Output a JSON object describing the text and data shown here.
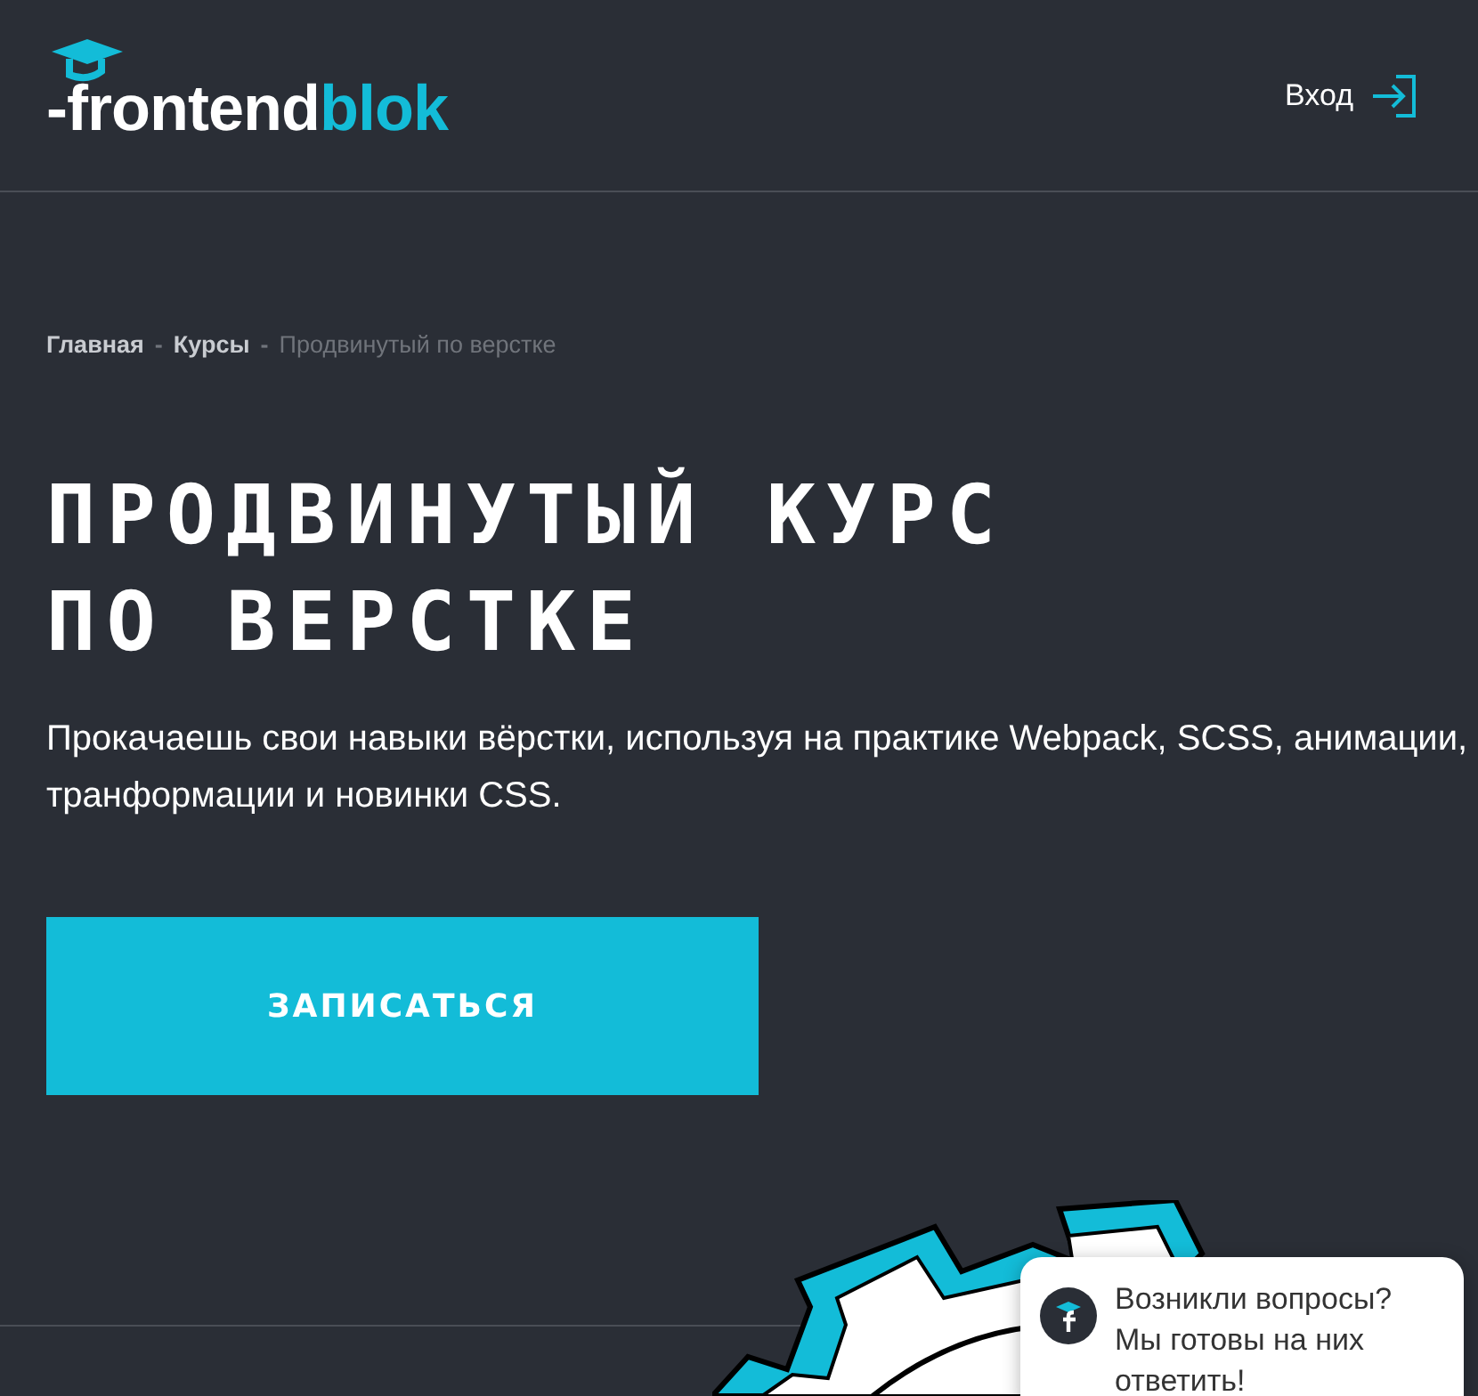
{
  "header": {
    "logo": {
      "part_1": "-frontend",
      "part_2": "blok"
    },
    "login": "Вход"
  },
  "breadcrumbs": [
    {
      "label": "Главная",
      "current": false
    },
    {
      "label": "Курсы",
      "current": false
    },
    {
      "label": "Продвинутый по верстке",
      "current": true
    }
  ],
  "separator": "-",
  "title_lines": [
    "ПРОДВИНУТЫЙ КУРС",
    "ПО ВЕРСТКЕ"
  ],
  "description": "Прокачаешь свои навыки вёрстки, используя на практике Webpack, SCSS, анимации, транформации и новинки CSS.",
  "cta_button": "ЗАПИСАТЬСЯ",
  "chat_popup": {
    "text": "Возникли вопросы? Мы готовы на них ответить!"
  }
}
